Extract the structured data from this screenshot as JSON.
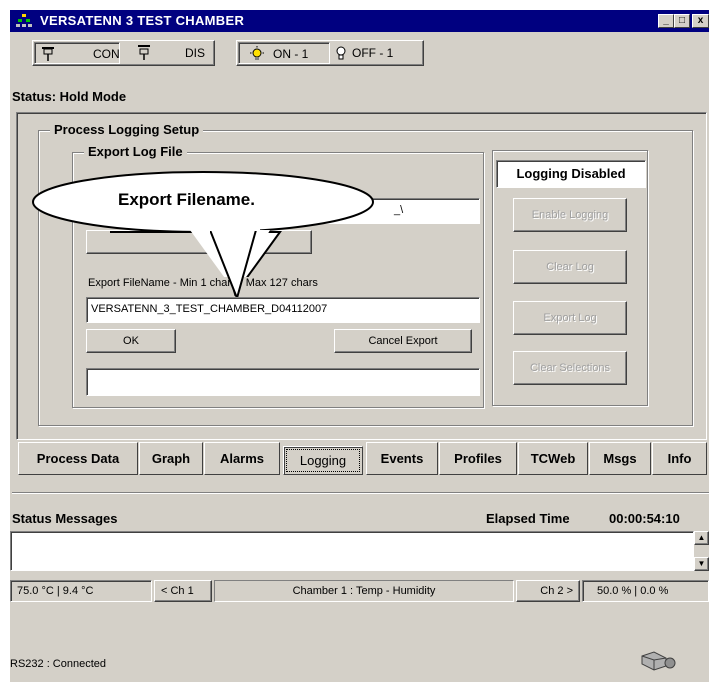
{
  "window": {
    "title": "VERSATENN 3 TEST CHAMBER"
  },
  "caption_buttons": {
    "minimize": "_",
    "maximize": "□",
    "close": "x"
  },
  "toolbar": {
    "con_label": "CON",
    "dis_label": "DIS",
    "on_label": "ON - 1",
    "off_label": "OFF - 1"
  },
  "status": {
    "text": "Status:  Hold Mode"
  },
  "logging_setup": {
    "group_title": "Process Logging Setup",
    "export_group_title": "Export Log File",
    "path_value": "_\\",
    "callout_text": "Export Filename.",
    "filename_hint": "Export FileName - Min 1 chars / Max 127 chars",
    "filename_value": "VERSATENN_3_TEST_CHAMBER_D04112007",
    "ok_label": "OK",
    "cancel_export_label": "Cancel Export",
    "message_value": ""
  },
  "logging_panel": {
    "status_label": "Logging Disabled",
    "enable_logging": "Enable Logging",
    "clear_log": "Clear Log",
    "export_log": "Export Log",
    "clear_selections": "Clear Selections"
  },
  "tabs": [
    "Process Data",
    "Graph",
    "Alarms",
    "Logging",
    "Events",
    "Profiles",
    "TCWeb",
    "Msgs",
    "Info"
  ],
  "status_messages": {
    "title": "Status Messages",
    "elapsed_label": "Elapsed Time",
    "elapsed_value": "00:00:54:10",
    "log_text": ""
  },
  "channel_bar": {
    "ch1_readout": "75.0 °C  |  9.4 °C",
    "prev_button": "< Ch 1",
    "chamber_label": "Chamber 1 : Temp - Humidity",
    "next_button": "Ch 2 >",
    "ch2_readout": "50.0 %  |  0.0 %"
  },
  "footer": {
    "connection": "RS232 : Connected"
  },
  "colors": {
    "titlebar": "#000080",
    "face": "#d4d0c8"
  }
}
